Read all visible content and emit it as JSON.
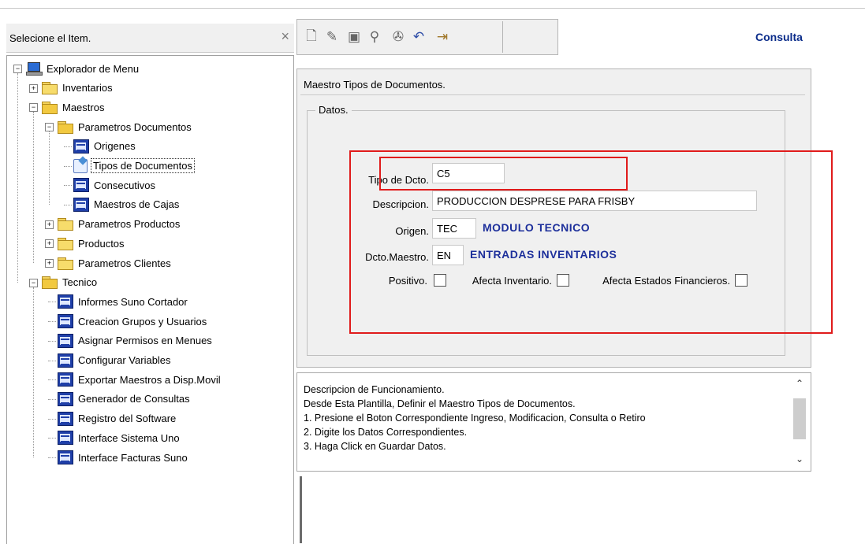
{
  "left_panel": {
    "title": "Selecione el Item.",
    "close_icon": "close-icon",
    "tree": [
      {
        "label": "Explorador de Menu",
        "icon": "computer-icon",
        "level": 0,
        "expander": "minus"
      },
      {
        "label": "Inventarios",
        "icon": "folder-icon",
        "level": 1,
        "expander": "plus"
      },
      {
        "label": "Maestros",
        "icon": "folder-open-icon",
        "level": 1,
        "expander": "minus"
      },
      {
        "label": "Parametros Documentos",
        "icon": "folder-open-icon",
        "level": 2,
        "expander": "minus"
      },
      {
        "label": "Origenes",
        "icon": "form-icon",
        "level": 3
      },
      {
        "label": "Tipos de Documentos",
        "icon": "document-icon",
        "level": 3,
        "selected": true
      },
      {
        "label": "Consecutivos",
        "icon": "form-icon",
        "level": 3
      },
      {
        "label": "Maestros de Cajas",
        "icon": "form-icon",
        "level": 3
      },
      {
        "label": "Parametros Productos",
        "icon": "folder-icon",
        "level": 2,
        "expander": "plus"
      },
      {
        "label": "Productos",
        "icon": "folder-icon",
        "level": 2,
        "expander": "plus"
      },
      {
        "label": "Parametros Clientes",
        "icon": "folder-icon",
        "level": 2,
        "expander": "plus"
      },
      {
        "label": "Tecnico",
        "icon": "folder-open-icon",
        "level": 1,
        "expander": "minus"
      },
      {
        "label": "Informes Suno Cortador",
        "icon": "form-icon",
        "level": 2
      },
      {
        "label": "Creacion  Grupos y Usuarios",
        "icon": "form-icon",
        "level": 2
      },
      {
        "label": "Asignar Permisos en Menues",
        "icon": "form-icon",
        "level": 2
      },
      {
        "label": "Configurar Variables",
        "icon": "form-icon",
        "level": 2
      },
      {
        "label": "Exportar Maestros a Disp.Movil",
        "icon": "form-icon",
        "level": 2
      },
      {
        "label": "Generador de Consultas",
        "icon": "form-icon",
        "level": 2
      },
      {
        "label": "Registro del Software",
        "icon": "form-icon",
        "level": 2
      },
      {
        "label": "Interface Sistema Uno",
        "icon": "form-icon",
        "level": 2
      },
      {
        "label": "Interface Facturas Suno",
        "icon": "form-icon",
        "level": 2
      }
    ]
  },
  "toolbar": {
    "buttons": [
      {
        "name": "new-document-icon",
        "glyph": "🗋"
      },
      {
        "name": "edit-icon",
        "glyph": "✎"
      },
      {
        "name": "save-icon",
        "glyph": "▣"
      },
      {
        "name": "search-icon",
        "glyph": "⚲"
      },
      {
        "name": "delete-icon",
        "glyph": "✇"
      },
      {
        "name": "undo-icon",
        "glyph": "↶"
      },
      {
        "name": "exit-icon",
        "glyph": "⇥"
      }
    ]
  },
  "mode_label": "Consulta",
  "form": {
    "title": "Maestro Tipos de Documentos.",
    "fieldset_legend": "Datos.",
    "tipo_label": "Tipo de Dcto.",
    "tipo_value": "C5",
    "descripcion_label": "Descripcion.",
    "descripcion_value": "PRODUCCION DESPRESE PARA FRISBY",
    "origen_label": "Origen.",
    "origen_value": "TEC",
    "origen_desc": "MODULO TECNICO",
    "maestro_label": "Dcto.Maestro.",
    "maestro_value": "EN",
    "maestro_desc": "ENTRADAS INVENTARIOS",
    "positivo_label": "Positivo.",
    "positivo_checked": false,
    "afecta_inv_label": "Afecta Inventario.",
    "afecta_inv_checked": false,
    "afecta_fin_label": "Afecta Estados Financieros.",
    "afecta_fin_checked": false
  },
  "description": {
    "lines": [
      "Descripcion de Funcionamiento.",
      "Desde Esta Plantilla, Definir el Maestro Tipos de Documentos.",
      "1. Presione el Boton Correspondiente Ingreso, Modificacion, Consulta o Retiro",
      "2. Digite los Datos Correspondientes.",
      "3. Haga Click en Guardar Datos."
    ]
  },
  "colors": {
    "annotation_red": "#e01b1b",
    "blue_text": "#1d2f9b",
    "mode_blue": "#0b2c8a"
  }
}
